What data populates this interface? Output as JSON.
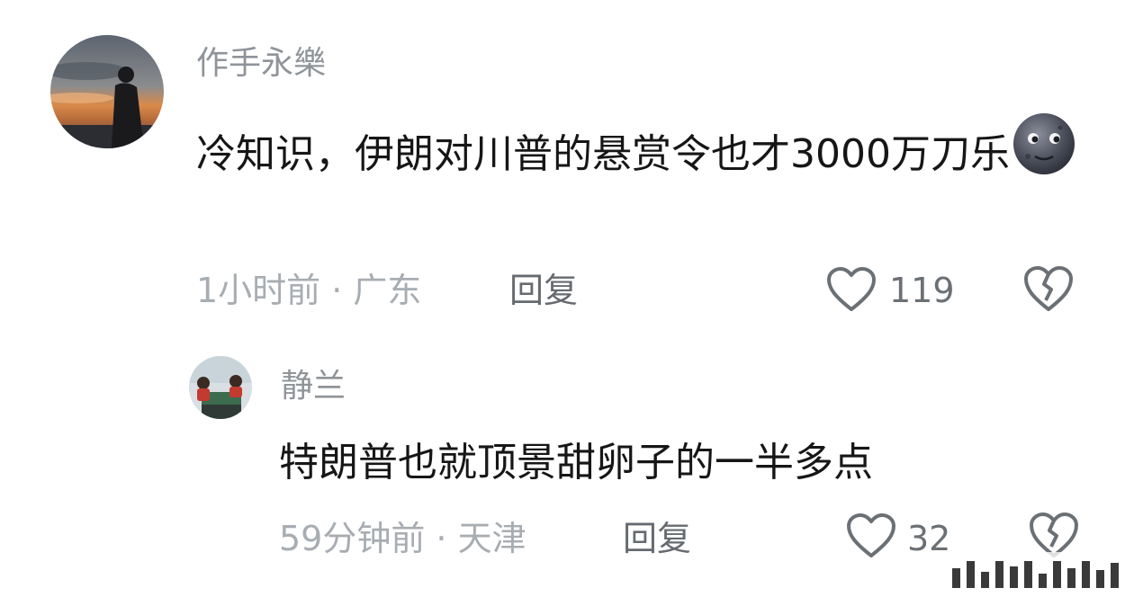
{
  "comment": {
    "username": "作手永樂",
    "text": "冷知识，伊朗对川普的悬赏令也才3000万刀乐",
    "emoji": "new-moon-face-emoji",
    "meta": "1小时前 · 广东",
    "reply_label": "回复",
    "like_count": "119",
    "like_icon": "heart-outline-icon",
    "dislike_icon": "broken-heart-icon"
  },
  "reply": {
    "username": "静兰",
    "text": "特朗普也就顶景甜卵子的一半多点",
    "meta": "59分钟前 · 天津",
    "reply_label": "回复",
    "like_count": "32",
    "like_icon": "heart-outline-icon",
    "dislike_icon": "broken-heart-icon"
  },
  "colors": {
    "username": "#8f9499",
    "body_text": "#161616",
    "meta_text": "#a8adb2",
    "reply_link": "#666b70",
    "icon_stroke": "#6b7075"
  }
}
